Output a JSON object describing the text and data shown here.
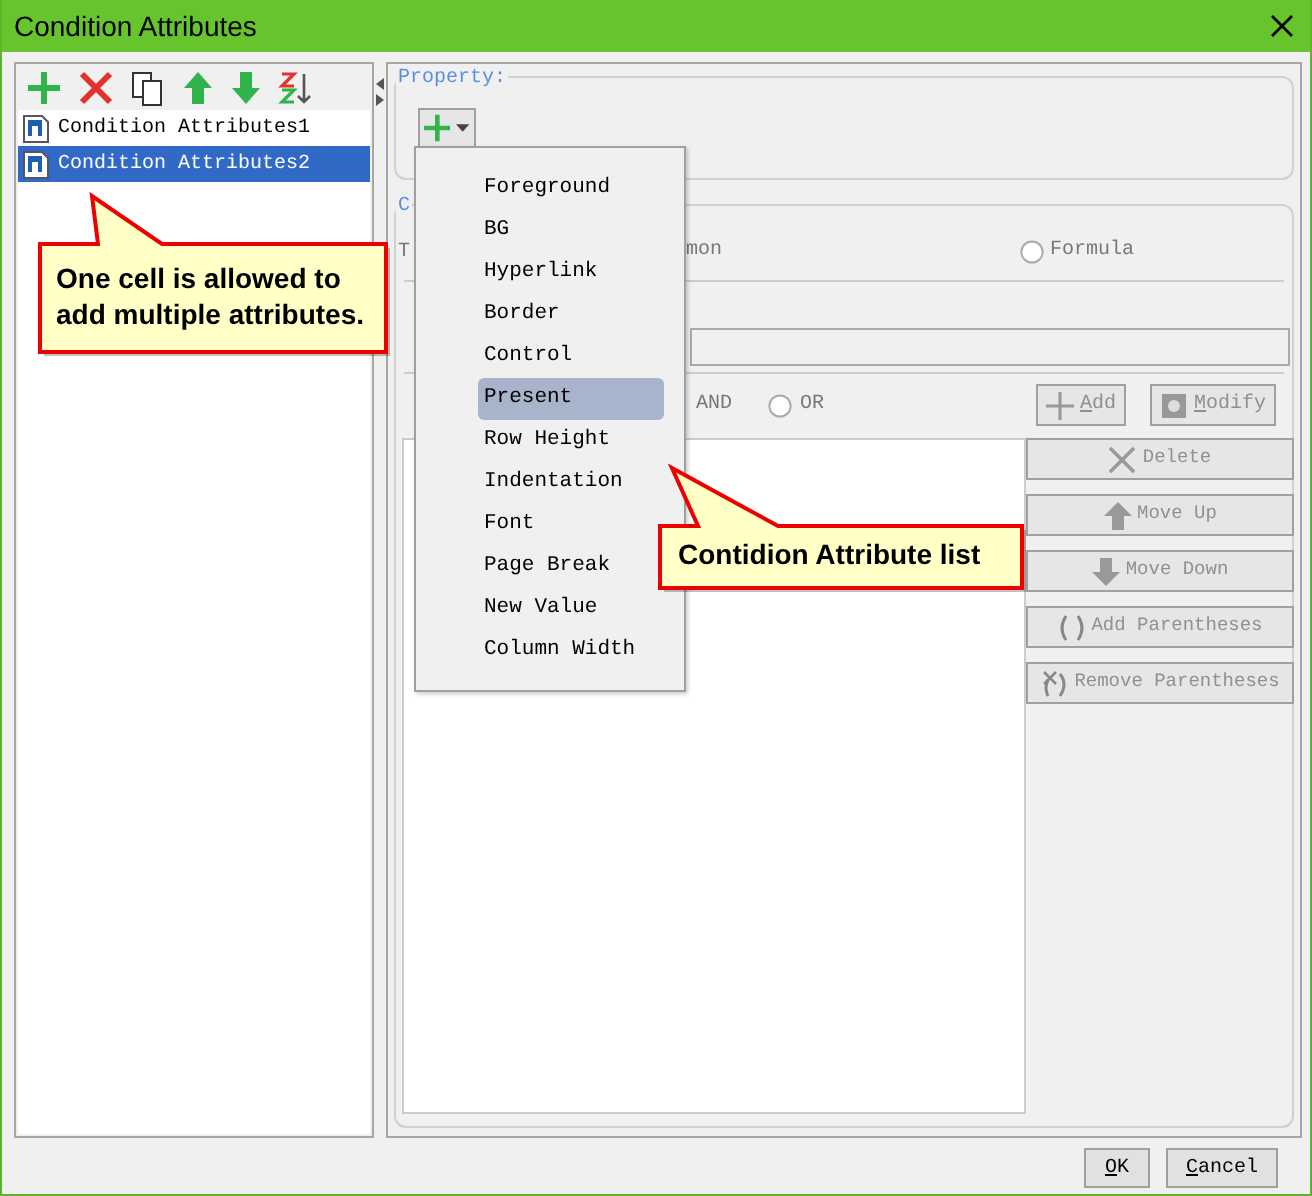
{
  "window": {
    "title": "Condition Attributes"
  },
  "conditions": [
    {
      "label": "Condition Attributes1",
      "selected": false
    },
    {
      "label": "Condition Attributes2",
      "selected": true
    }
  ],
  "property": {
    "legend": "Property:"
  },
  "attribute_menu": [
    {
      "label": "Foreground",
      "selected": false
    },
    {
      "label": "BG",
      "selected": false
    },
    {
      "label": "Hyperlink",
      "selected": false
    },
    {
      "label": "Border",
      "selected": false
    },
    {
      "label": "Control",
      "selected": false
    },
    {
      "label": "Present",
      "selected": true
    },
    {
      "label": "Row Height",
      "selected": false
    },
    {
      "label": "Indentation",
      "selected": false
    },
    {
      "label": "Font",
      "selected": false
    },
    {
      "label": "Page Break",
      "selected": false
    },
    {
      "label": "New Value",
      "selected": false
    },
    {
      "label": "Column Width",
      "selected": false
    }
  ],
  "condition_group": {
    "legend": "C",
    "type_label": "T",
    "type_options": [
      {
        "label": "mon"
      },
      {
        "label": "Formula",
        "selected": false
      }
    ],
    "logic_options": [
      {
        "label": "AND"
      },
      {
        "label": "OR",
        "selected": false
      }
    ],
    "top_buttons": [
      {
        "kind": "add",
        "label": "Add",
        "disabled": true
      },
      {
        "kind": "modify",
        "label": "Modify",
        "disabled": true
      }
    ],
    "side_buttons": [
      {
        "kind": "delete",
        "label": "Delete",
        "disabled": true
      },
      {
        "kind": "up",
        "label": "Move Up",
        "disabled": true
      },
      {
        "kind": "down",
        "label": "Move Down",
        "disabled": true
      },
      {
        "kind": "paren",
        "label": "Add Parentheses",
        "disabled": true
      },
      {
        "kind": "unparen",
        "label": "Remove Parentheses",
        "disabled": true
      }
    ]
  },
  "callouts": [
    {
      "kind": "list",
      "text": "One cell is allowed to add multiple attributes."
    },
    {
      "kind": "menu",
      "text": "Contidion Attribute list"
    }
  ],
  "footer_buttons": [
    {
      "label": "OK"
    },
    {
      "label": "Cancel"
    }
  ]
}
